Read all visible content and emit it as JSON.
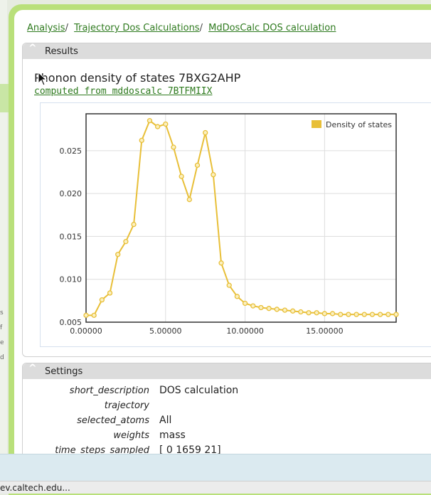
{
  "breadcrumb": [
    {
      "label": "Analysis"
    },
    {
      "label": "Trajectory Dos Calculations"
    },
    {
      "label": "MdDosCalc DOS calculation"
    }
  ],
  "left_clip": [
    "s",
    "f",
    "e",
    "d"
  ],
  "results": {
    "header": "Results",
    "title": "Phonon density of states 7BXG2AHP",
    "link": "computed from mddoscalc 7BTFMIIX"
  },
  "chart_data": {
    "type": "line",
    "series": [
      {
        "name": "Density of states",
        "color": "#e8bf38",
        "x": [
          0,
          0.5,
          1.0,
          1.5,
          2.0,
          2.5,
          3.0,
          3.5,
          4.0,
          4.5,
          5.0,
          5.5,
          6.0,
          6.5,
          7.0,
          7.5,
          8.0,
          8.5,
          9.0,
          9.5,
          10.0,
          10.5,
          11.0,
          11.5,
          12.0,
          12.5,
          13.0,
          13.5,
          14.0,
          14.5,
          15.0,
          15.5,
          16.0,
          16.5,
          17.0,
          17.5,
          18.0,
          18.5,
          19.0,
          19.5
        ],
        "y": [
          0.0058,
          0.0058,
          0.0076,
          0.0084,
          0.0129,
          0.0144,
          0.0164,
          0.0262,
          0.0285,
          0.0278,
          0.0281,
          0.0254,
          0.022,
          0.0193,
          0.0233,
          0.0271,
          0.0222,
          0.0119,
          0.0093,
          0.008,
          0.0072,
          0.0069,
          0.0067,
          0.0066,
          0.0065,
          0.0064,
          0.0063,
          0.0062,
          0.0061,
          0.0061,
          0.006,
          0.006,
          0.0059,
          0.0059,
          0.0059,
          0.0059,
          0.0059,
          0.0059,
          0.0059,
          0.0059
        ]
      }
    ],
    "xlim": [
      0,
      19.5
    ],
    "ylim": [
      0.005,
      0.0293
    ],
    "xticks": [
      0,
      5,
      10,
      15
    ],
    "xtick_labels": [
      "0.00000",
      "5.00000",
      "10.00000",
      "15.00000"
    ],
    "yticks": [
      0.005,
      0.01,
      0.015,
      0.02,
      0.025
    ],
    "ytick_labels": [
      "0.005",
      "0.010",
      "0.015",
      "0.020",
      "0.025"
    ],
    "grid": true,
    "legend": "top-right"
  },
  "settings": {
    "header": "Settings",
    "rows": [
      {
        "key": "short_description",
        "value": "DOS calculation"
      },
      {
        "key": "trajectory",
        "value": ""
      },
      {
        "key": "selected_atoms",
        "value": "All"
      },
      {
        "key": "weights",
        "value": "mass"
      },
      {
        "key": "time_steps_sampled",
        "value": "[ 0 1659 21]"
      }
    ]
  },
  "status": {
    "text": "ev.caltech.edu..."
  }
}
